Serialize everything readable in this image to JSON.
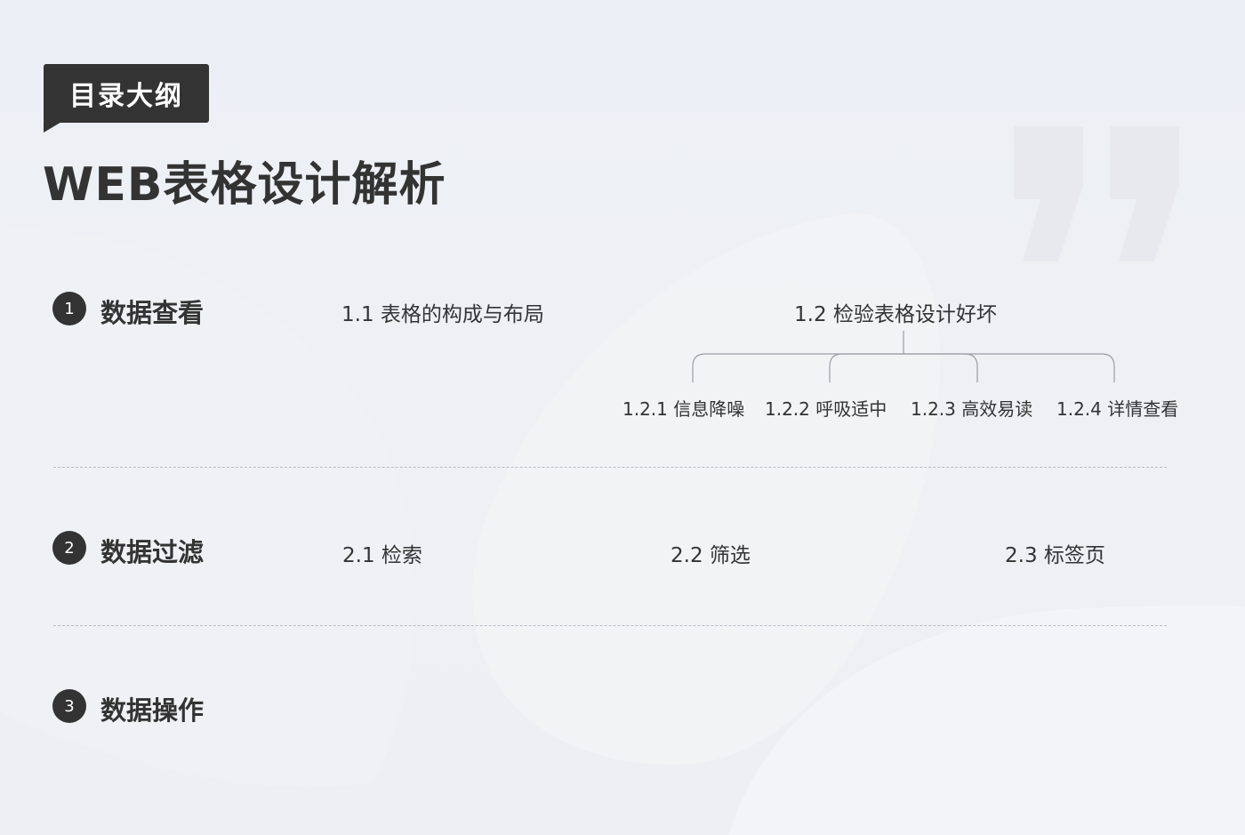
{
  "tag": {
    "label": "目录大纲"
  },
  "title": "WEB表格设计解析",
  "sections": [
    {
      "number": "1",
      "name": "数据查看",
      "items": [
        {
          "label": "1.1 表格的构成与布局"
        },
        {
          "label": "1.2 检验表格设计好坏",
          "children": [
            "1.2.1 信息降噪",
            "1.2.2 呼吸适中",
            "1.2.3 高效易读",
            "1.2.4 详情查看"
          ]
        }
      ]
    },
    {
      "number": "2",
      "name": "数据过滤",
      "items": [
        {
          "label": "2.1 检索"
        },
        {
          "label": "2.2 筛选"
        },
        {
          "label": "2.3 标签页"
        }
      ]
    },
    {
      "number": "3",
      "name": "数据操作",
      "items": []
    }
  ],
  "colors": {
    "dark": "#333333",
    "background": "#eceff5",
    "divider": "#b8bcc4"
  },
  "icons": {
    "decoration": "quote-mark-icon"
  }
}
